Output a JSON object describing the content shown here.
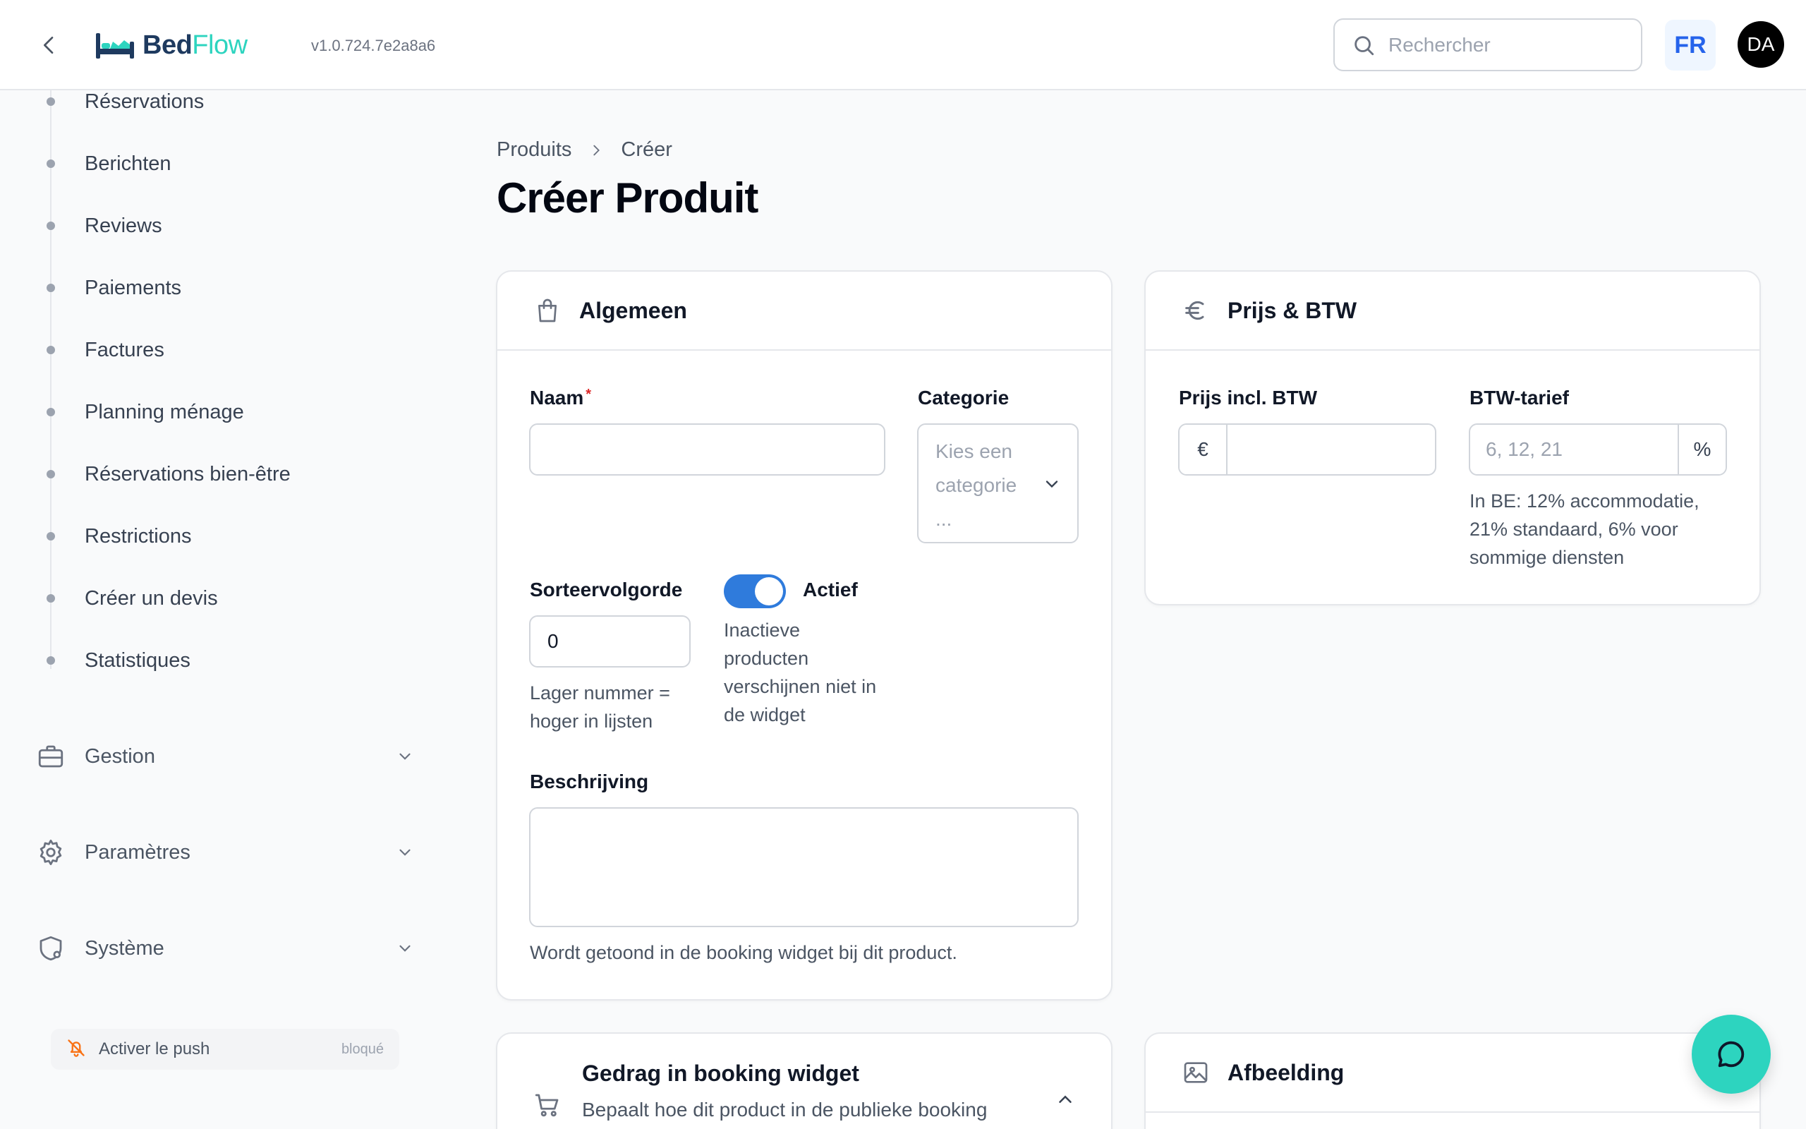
{
  "header": {
    "logo_bed": "Bed",
    "logo_flow": "Flow",
    "version": "v1.0.724.7e2a8a6",
    "search_placeholder": "Rechercher",
    "language": "FR",
    "avatar_initials": "DA"
  },
  "sidebar": {
    "sub_items": [
      {
        "label": "Réservations"
      },
      {
        "label": "Berichten"
      },
      {
        "label": "Reviews"
      },
      {
        "label": "Paiements"
      },
      {
        "label": "Factures"
      },
      {
        "label": "Planning ménage"
      },
      {
        "label": "Réservations bien-être"
      },
      {
        "label": "Restrictions"
      },
      {
        "label": "Créer un devis"
      },
      {
        "label": "Statistiques"
      }
    ],
    "groups": [
      {
        "label": "Gestion",
        "icon": "briefcase-icon"
      },
      {
        "label": "Paramètres",
        "icon": "gear-icon"
      },
      {
        "label": "Système",
        "icon": "shield-gear-icon"
      }
    ],
    "push": {
      "label": "Activer le push",
      "status": "bloqué",
      "icon": "bell-off-icon"
    }
  },
  "breadcrumb": {
    "parent": "Produits",
    "current": "Créer"
  },
  "page_title": "Créer Produit",
  "general_card": {
    "title": "Algemeen",
    "name_label": "Naam",
    "name_required": "*",
    "name_value": "",
    "category_label": "Categorie",
    "category_placeholder": "Kies een categorie ...",
    "sort_label": "Sorteervolgorde",
    "sort_value": "0",
    "sort_hint": "Lager nummer = hoger in lijsten",
    "active_label": "Actief",
    "active_on": true,
    "active_hint": "Inactieve producten verschijnen niet in de widget",
    "description_label": "Beschrijving",
    "description_value": "",
    "description_hint": "Wordt getoond in de booking widget bij dit product."
  },
  "price_card": {
    "title": "Prijs & BTW",
    "price_label": "Prijs incl. BTW",
    "currency": "€",
    "price_value": "",
    "vat_label": "BTW-tarief",
    "vat_placeholder": "6, 12, 21",
    "vat_suffix": "%",
    "vat_hint": "In BE: 12% accommodatie, 21% standaard, 6% voor sommige diensten"
  },
  "behaviour_card": {
    "title": "Gedrag in booking widget",
    "subtitle": "Bepaalt hoe dit product in de publieke booking"
  },
  "image_card": {
    "title": "Afbeelding"
  },
  "colors": {
    "accent": "#2f7bdc",
    "brand_teal": "#2dd4bf",
    "brand_navy": "#1e3a5f"
  }
}
